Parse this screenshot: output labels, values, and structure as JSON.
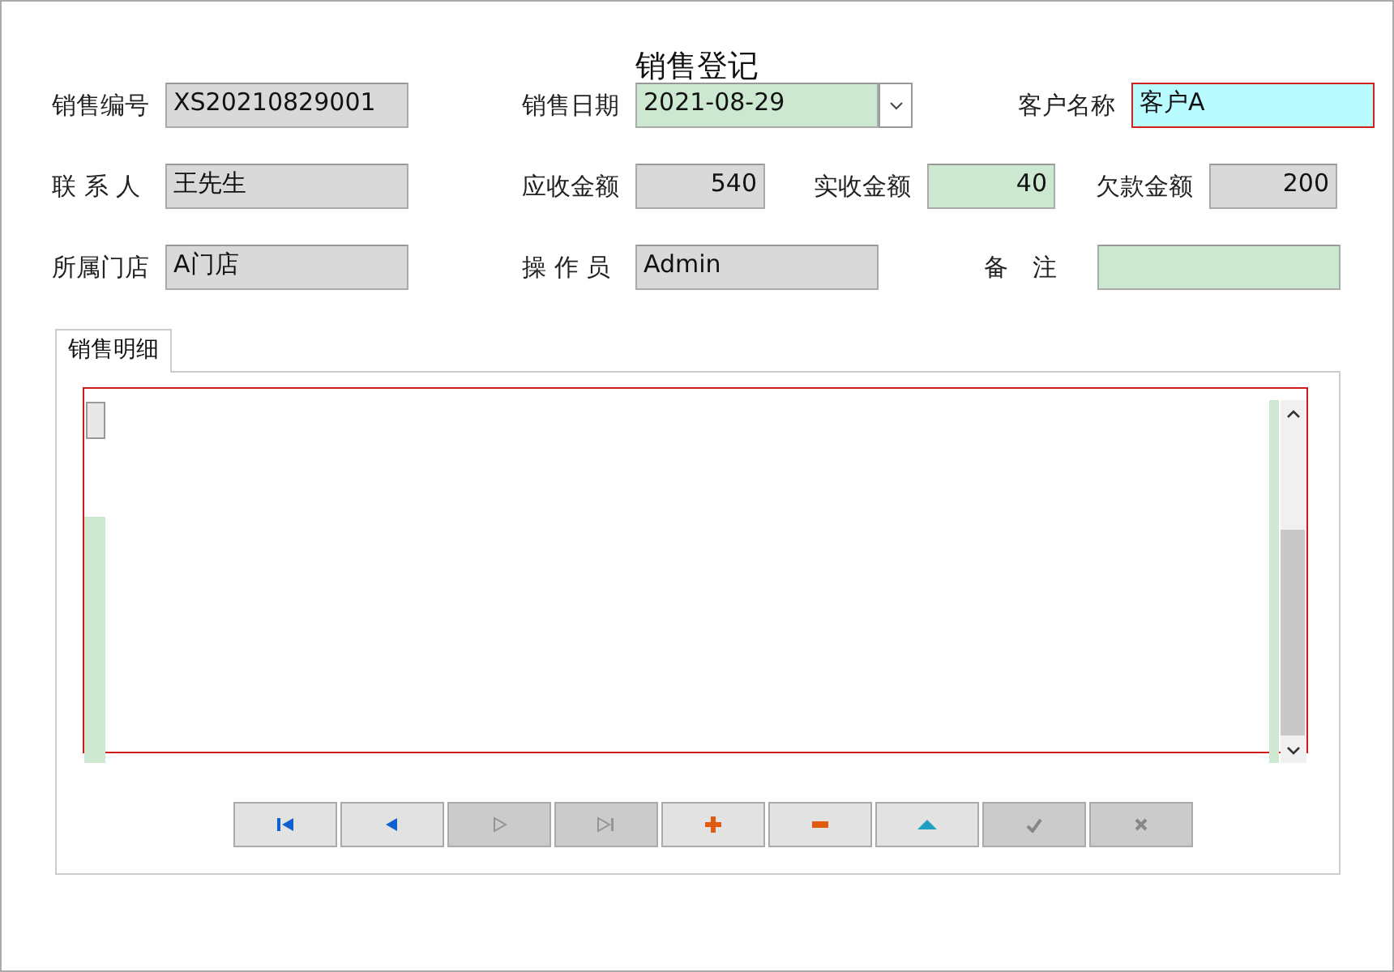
{
  "window": {
    "title": "销售登记"
  },
  "form_rows": [
    [
      {
        "label": "销售编号",
        "value": "XS20210829001",
        "kind": "text",
        "editable": false,
        "focused": false
      },
      {
        "label": "销售日期",
        "value": "2021-08-29",
        "kind": "date",
        "editable": true,
        "focused": false
      },
      {
        "label": "客户名称",
        "value": "客户A",
        "kind": "text",
        "editable": true,
        "focused": true
      }
    ],
    [
      {
        "label": "联 系 人",
        "value": "王先生",
        "kind": "text",
        "editable": false,
        "focused": false
      },
      {
        "label": "应收金额",
        "value": "540",
        "kind": "number",
        "editable": false,
        "focused": false
      },
      {
        "label": "实收金额",
        "value": "40",
        "kind": "number",
        "editable": true,
        "focused": false
      },
      {
        "label": "欠款金额",
        "value": "200",
        "kind": "number",
        "editable": false,
        "focused": false
      }
    ],
    [
      {
        "label": "所属门店",
        "value": "A门店",
        "kind": "text",
        "editable": false,
        "focused": false
      },
      {
        "label": "操 作 员",
        "value": "Admin",
        "kind": "text",
        "editable": false,
        "focused": false
      },
      {
        "label": "备　注",
        "kind": "text",
        "editable": true,
        "focused": false
      }
    ]
  ],
  "tabs": [
    {
      "label": "销售明细",
      "selected": true
    }
  ],
  "navigator": [
    {
      "kind": "first",
      "disabled": false
    },
    {
      "kind": "prior",
      "disabled": false
    },
    {
      "kind": "next",
      "disabled": true
    },
    {
      "kind": "last",
      "disabled": true
    },
    {
      "kind": "insert",
      "disabled": false
    },
    {
      "kind": "delete",
      "disabled": false
    },
    {
      "kind": "edit",
      "disabled": false
    },
    {
      "kind": "post",
      "disabled": true
    },
    {
      "kind": "cancel",
      "disabled": true
    }
  ]
}
